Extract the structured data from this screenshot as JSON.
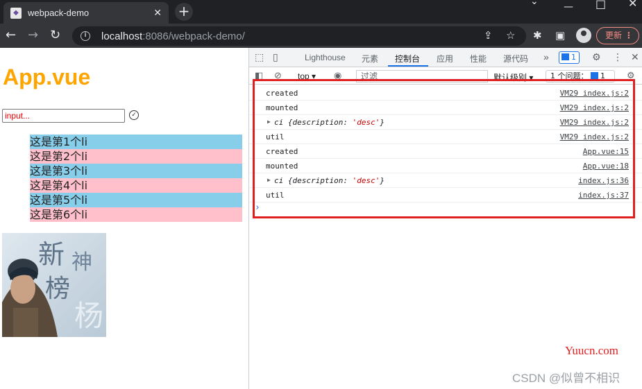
{
  "browser": {
    "tab_title": "webpack-demo",
    "tab_close": "✕",
    "new_tab": "+",
    "url_host": "localhost",
    "url_rest": ":8086/webpack-demo/",
    "update_label": "更新"
  },
  "page": {
    "title": "App.vue",
    "input_placeholder": "input...",
    "list_items": [
      "这是第1个li",
      "这是第2个li",
      "这是第3个li",
      "这是第4个li",
      "这是第5个li",
      "这是第6个li"
    ],
    "colors": {
      "title": "#ffa500",
      "odd_row": "#87ceeb",
      "even_row": "#ffc0cb"
    },
    "poster_chars": [
      "新",
      "神",
      "榜",
      "杨"
    ]
  },
  "devtools": {
    "tabs": [
      "Lighthouse",
      "元素",
      "控制台",
      "应用",
      "性能",
      "源代码"
    ],
    "active_tab": "控制台",
    "more": "»",
    "issue_badge": "1",
    "context": "top ▾",
    "filter_placeholder": "过滤",
    "level": "默认级别 ▾",
    "issues": "1 个问题：",
    "issues_count": "1",
    "logs": [
      {
        "message": "created",
        "source": "VM29 index.js:2"
      },
      {
        "message": "mounted",
        "source": "VM29 index.js:2"
      },
      {
        "obj_name": "ci",
        "obj_open": " {description: ",
        "obj_value": "'desc'",
        "obj_close": "}",
        "source": "VM29 index.js:2"
      },
      {
        "message": "util",
        "source": "VM29 index.js:2"
      },
      {
        "message": "created",
        "source": "App.vue:15"
      },
      {
        "message": "mounted",
        "source": "App.vue:18"
      },
      {
        "obj_name": "ci",
        "obj_open": " {description: ",
        "obj_value": "'desc'",
        "obj_close": "}",
        "source": "index.js:36"
      },
      {
        "message": "util",
        "source": "index.js:37"
      }
    ]
  },
  "watermarks": {
    "site": "Yuucn.com",
    "csdn": "CSDN @似曾不相识"
  },
  "icons": [
    "back-arrow-icon",
    "forward-arrow-icon",
    "reload-icon",
    "info-icon",
    "share-icon",
    "star-icon",
    "extensions-icon",
    "sidepanel-icon",
    "profile-icon",
    "more-vert-icon",
    "inspect-icon",
    "device-icon",
    "gear-icon",
    "ellipsis-icon",
    "close-icon",
    "sidebar-icon",
    "clear-icon",
    "eye-icon",
    "check-circle-icon"
  ]
}
